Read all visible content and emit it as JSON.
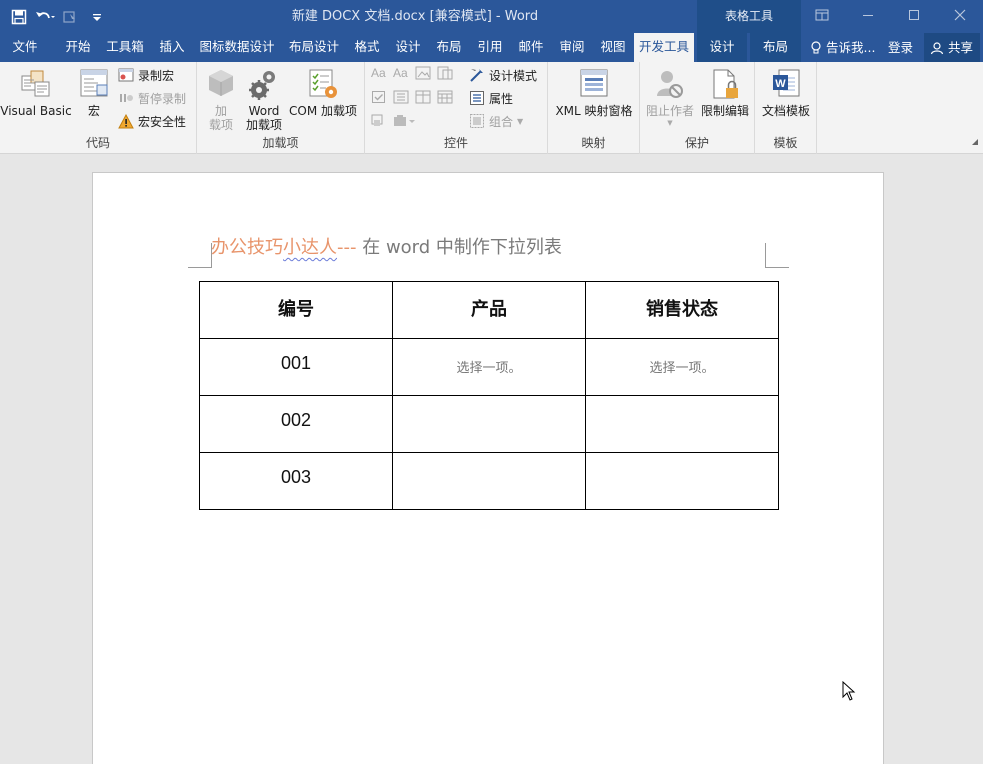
{
  "window": {
    "title": "新建 DOCX 文档.docx [兼容模式] - Word",
    "context_group": "表格工具"
  },
  "tabs": {
    "file": "文件",
    "home": "开始",
    "toolbox": "工具箱",
    "insert": "插入",
    "chart_design": "图标数据设计",
    "layout_design": "布局设计",
    "format": "格式",
    "design": "设计",
    "layout": "布局",
    "references": "引用",
    "mailings": "邮件",
    "review": "审阅",
    "view": "视图",
    "developer": "开发工具",
    "table_design": "设计",
    "table_layout": "布局",
    "tell_me": "告诉我...",
    "login": "登录",
    "share": "共享"
  },
  "ribbon": {
    "code": {
      "label": "代码",
      "visual_basic": "Visual Basic",
      "macros": "宏",
      "record_macro": "录制宏",
      "pause_recording": "暂停录制",
      "macro_security": "宏安全性"
    },
    "addins": {
      "label": "加载项",
      "addins_line1": "加",
      "addins_line2": "载项",
      "word_addins_line1": "Word",
      "word_addins_line2": "加载项",
      "com_addins": "COM 加载项"
    },
    "controls": {
      "label": "控件",
      "design_mode": "设计模式",
      "properties": "属性",
      "group": "组合"
    },
    "mapping": {
      "label": "映射",
      "xml_pane": "XML 映射窗格"
    },
    "protect": {
      "label": "保护",
      "block_authors": "阻止作者",
      "restrict_editing": "限制编辑"
    },
    "templates": {
      "label": "模板",
      "document_template": "文档模板"
    }
  },
  "document": {
    "heading_part1": "办公技巧",
    "heading_part2": "小达人",
    "heading_part3": "---",
    "heading_part4": " 在 word 中制作下拉列表",
    "table": {
      "headers": [
        "编号",
        "产品",
        "销售状态"
      ],
      "rows": [
        [
          "001",
          "选择一项。",
          "选择一项。"
        ],
        [
          "002",
          "",
          ""
        ],
        [
          "003",
          "",
          ""
        ]
      ]
    }
  }
}
